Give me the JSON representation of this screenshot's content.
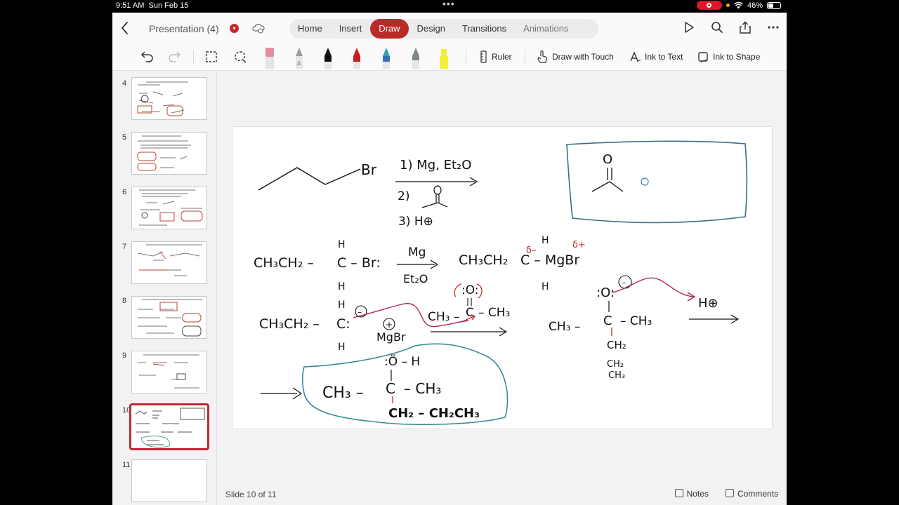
{
  "status_bar": {
    "time": "9:51 AM",
    "date": "Sun Feb 15",
    "battery": "46%",
    "battery_level_pct": 46
  },
  "header": {
    "doc_title": "Presentation (4)",
    "tabs": [
      {
        "label": "Home"
      },
      {
        "label": "Insert"
      },
      {
        "label": "Draw"
      },
      {
        "label": "Design"
      },
      {
        "label": "Transitions"
      },
      {
        "label": "Animations"
      }
    ],
    "active_tab": "Draw"
  },
  "ribbon": {
    "ruler_label": "Ruler",
    "draw_with_touch_label": "Draw with Touch",
    "ink_to_text_label": "Ink to Text",
    "ink_to_shape_label": "Ink to Shape",
    "pen_colors": [
      "#e98aa5",
      "#9a9a9a",
      "#111111",
      "#c91d22",
      "#2aa3b7",
      "#7a8a86",
      "#f4ef3a"
    ]
  },
  "sidebar": {
    "slides": [
      {
        "number": "4"
      },
      {
        "number": "5"
      },
      {
        "number": "6"
      },
      {
        "number": "7"
      },
      {
        "number": "8"
      },
      {
        "number": "9"
      },
      {
        "number": "10"
      },
      {
        "number": "11"
      }
    ],
    "selected": "10"
  },
  "slide_ink": {
    "row1": {
      "br": "Br",
      "step1": "1) Mg, Et₂O",
      "step2": "2)",
      "step3": "3) H⊕"
    },
    "row2": {
      "left_chain": "CH₃CH₂ –",
      "left_carbon": "C – Br:",
      "h": "H",
      "mg": "Mg",
      "et2o": "Et₂O",
      "right_chain": "CH₃CH₂",
      "right_group": "C – MgBr",
      "delta_minus": "δ–",
      "delta_plus": "δ+"
    },
    "row3": {
      "left_chain": "CH₃CH₂ –",
      "left_carbon": "C:",
      "mgbr": "MgBr",
      "plus": "+",
      "minus": "–",
      "ketone_left": "CH₃ –",
      "ketone_c": "C",
      "ketone_right": "– CH₃",
      "o_top": ":O:",
      "alkoxide_o": ":O:",
      "alkoxide_left": "CH₃ –",
      "alkoxide_right": "– CH₃",
      "ch2": "CH₂",
      "ch2b": "CH₂",
      "ch3b": "CH₃",
      "h_plus": "H⊕"
    },
    "product": {
      "oh": ":Ö – H",
      "left": "CH₃ –",
      "c": "C",
      "right": "– CH₃",
      "bottom": "CH₂ – CH₂CH₃"
    },
    "box": {
      "o": "O"
    }
  },
  "footer": {
    "slide_indicator": "Slide 10 of 11",
    "notes_label": "Notes",
    "comments_label": "Comments"
  }
}
